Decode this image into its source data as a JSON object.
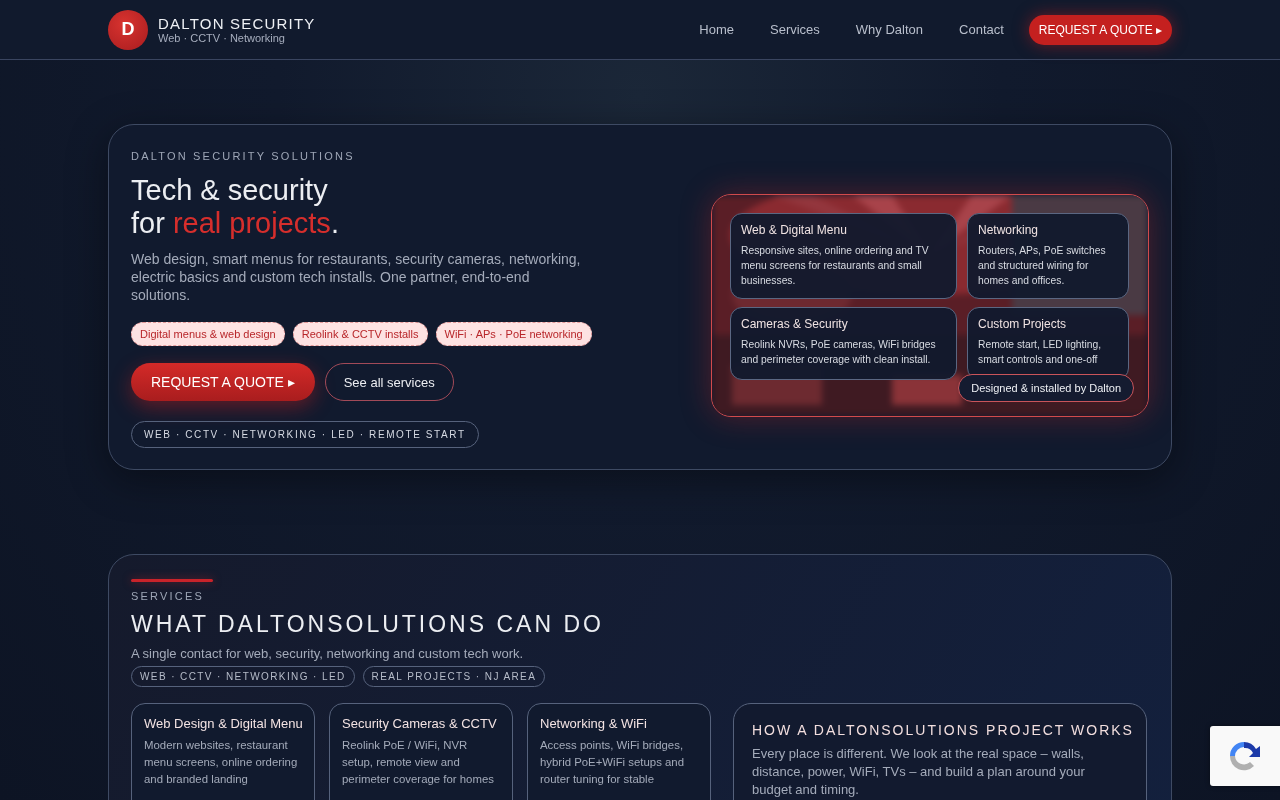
{
  "header": {
    "brand": {
      "initial": "D",
      "name": "DALTON SECURITY",
      "tagline": "Web · CCTV · Networking"
    },
    "nav": [
      {
        "label": "Home"
      },
      {
        "label": "Services"
      },
      {
        "label": "Why Dalton"
      },
      {
        "label": "Contact"
      }
    ],
    "cta": "REQUEST A QUOTE ▸"
  },
  "hero": {
    "eyebrow": "DALTON SECURITY SOLUTIONS",
    "title_line1": "Tech & security",
    "title_prefix": "for ",
    "title_highlight": "real projects",
    "title_suffix": ".",
    "description": "Web design, smart menus for restaurants, security cameras, networking, electric basics and custom tech installs. One partner, end-to-end solutions.",
    "tags": [
      "Digital menus & web design",
      "Reolink & CCTV installs",
      "WiFi · APs · PoE networking"
    ],
    "primary_button": "REQUEST A QUOTE ▸",
    "secondary_button": "See all services",
    "chip": "WEB · CCTV · NETWORKING · LED · REMOTE START",
    "panel": {
      "kind": "picture",
      "cards": [
        {
          "title": "Web & Digital Menu",
          "text": "Responsive sites, online ordering and TV menu screens for restaurants and small businesses."
        },
        {
          "title": "Networking",
          "text": "Routers, APs, PoE switches and structured wiring for homes and offices."
        },
        {
          "title": "Cameras & Security",
          "text": "Reolink NVRs, PoE cameras, WiFi bridges and perimeter coverage with clean install."
        },
        {
          "title": "Custom Projects",
          "text": "Remote start, LED lighting, smart controls and one-off"
        }
      ],
      "badge": "Designed & installed by Dalton"
    }
  },
  "services": {
    "eyebrow": "SERVICES",
    "title": "WHAT DALTONSOLUTIONS CAN DO",
    "subtitle": "A single contact for web, security, networking and custom tech work.",
    "chips": [
      "WEB · CCTV · NETWORKING · LED",
      "REAL PROJECTS · NJ AREA"
    ],
    "cards": [
      {
        "title": "Web Design & Digital Menu",
        "text": "Modern websites, restaurant menu screens, online ordering and branded landing"
      },
      {
        "title": "Security Cameras & CCTV",
        "text": "Reolink PoE / WiFi, NVR setup, remote view and perimeter coverage for homes"
      },
      {
        "title": "Networking & WiFi",
        "text": "Access points, WiFi bridges, hybrid PoE+WiFi setups and router tuning for stable"
      }
    ],
    "process": {
      "title": "HOW A DALTONSOLUTIONS PROJECT WORKS",
      "text": "Every place is different. We look at the real space – walls, distance, power, WiFi, TVs – and build a plan around your budget and timing."
    }
  }
}
